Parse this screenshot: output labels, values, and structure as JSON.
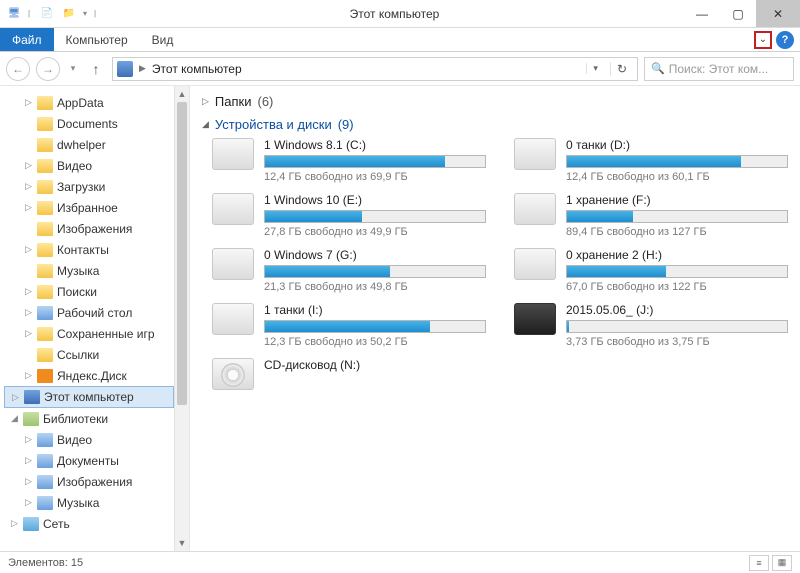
{
  "titlebar": {
    "title": "Этот компьютер"
  },
  "ribbon": {
    "file": "Файл",
    "computer": "Компьютер",
    "view": "Вид"
  },
  "nav": {
    "breadcrumb": "Этот компьютер",
    "search_placeholder": "Поиск: Этот ком..."
  },
  "tree": [
    {
      "depth": 1,
      "exp": "▷",
      "icon": "folder-y",
      "label": "AppData"
    },
    {
      "depth": 1,
      "exp": "",
      "icon": "folder-y",
      "label": "Documents"
    },
    {
      "depth": 1,
      "exp": "",
      "icon": "folder-y",
      "label": "dwhelper"
    },
    {
      "depth": 1,
      "exp": "▷",
      "icon": "folder-y",
      "label": "Видео"
    },
    {
      "depth": 1,
      "exp": "▷",
      "icon": "folder-y",
      "label": "Загрузки"
    },
    {
      "depth": 1,
      "exp": "▷",
      "icon": "folder-y",
      "label": "Избранное"
    },
    {
      "depth": 1,
      "exp": "",
      "icon": "folder-y",
      "label": "Изображения"
    },
    {
      "depth": 1,
      "exp": "▷",
      "icon": "folder-y",
      "label": "Контакты"
    },
    {
      "depth": 1,
      "exp": "",
      "icon": "folder-y",
      "label": "Музыка"
    },
    {
      "depth": 1,
      "exp": "▷",
      "icon": "folder-y",
      "label": "Поиски"
    },
    {
      "depth": 1,
      "exp": "▷",
      "icon": "folder-b",
      "label": "Рабочий стол"
    },
    {
      "depth": 1,
      "exp": "▷",
      "icon": "folder-y",
      "label": "Сохраненные игр"
    },
    {
      "depth": 1,
      "exp": "",
      "icon": "folder-y",
      "label": "Ссылки"
    },
    {
      "depth": 1,
      "exp": "▷",
      "icon": "icon-yd",
      "label": "Яндекс.Диск"
    },
    {
      "depth": 0,
      "exp": "▷",
      "icon": "icon-pc",
      "label": "Этот компьютер",
      "sel": true
    },
    {
      "depth": 0,
      "exp": "◢",
      "icon": "icon-lib",
      "label": "Библиотеки"
    },
    {
      "depth": 1,
      "exp": "▷",
      "icon": "folder-b",
      "label": "Видео"
    },
    {
      "depth": 1,
      "exp": "▷",
      "icon": "folder-b",
      "label": "Документы"
    },
    {
      "depth": 1,
      "exp": "▷",
      "icon": "folder-b",
      "label": "Изображения"
    },
    {
      "depth": 1,
      "exp": "▷",
      "icon": "folder-b",
      "label": "Музыка"
    },
    {
      "depth": 0,
      "exp": "▷",
      "icon": "icon-net",
      "label": "Сеть"
    }
  ],
  "groups": {
    "folders": {
      "title": "Папки",
      "count": "(6)",
      "expanded": false
    },
    "devices": {
      "title": "Устройства и диски",
      "count": "(9)",
      "expanded": true
    }
  },
  "drives": [
    {
      "name": "1 Windows 8.1 (C:)",
      "free": "12,4 ГБ свободно из 69,9 ГБ",
      "fill": 82,
      "type": "hdd"
    },
    {
      "name": "0 танки (D:)",
      "free": "12,4 ГБ свободно из 60,1 ГБ",
      "fill": 79,
      "type": "hdd"
    },
    {
      "name": "1 Windows 10 (E:)",
      "free": "27,8 ГБ свободно из 49,9 ГБ",
      "fill": 44,
      "type": "hdd"
    },
    {
      "name": "1 хранение (F:)",
      "free": "89,4 ГБ свободно из 127 ГБ",
      "fill": 30,
      "type": "hdd"
    },
    {
      "name": "0 Windows 7 (G:)",
      "free": "21,3 ГБ свободно из 49,8 ГБ",
      "fill": 57,
      "type": "hdd"
    },
    {
      "name": "0 хранение 2 (H:)",
      "free": "67,0 ГБ свободно из 122 ГБ",
      "fill": 45,
      "type": "hdd"
    },
    {
      "name": "1 танки (I:)",
      "free": "12,3 ГБ свободно из 50,2 ГБ",
      "fill": 75,
      "type": "hdd"
    },
    {
      "name": "2015.05.06_ (J:)",
      "free": "3,73 ГБ свободно из 3,75 ГБ",
      "fill": 1,
      "type": "ext"
    },
    {
      "name": "CD-дисковод (N:)",
      "free": "",
      "fill": -1,
      "type": "optical"
    }
  ],
  "status": {
    "items": "Элементов: 15"
  }
}
